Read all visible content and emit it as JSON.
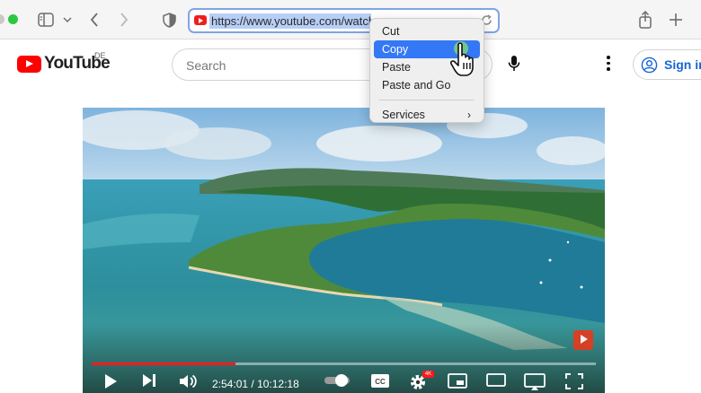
{
  "browser": {
    "url": "https://www.youtube.com/watch?"
  },
  "header": {
    "logo_text": "YouTube",
    "region": "DE",
    "search_placeholder": "Search",
    "signin_label": "Sign in"
  },
  "player": {
    "time_current": "2:54:01",
    "time_total": "10:12:18",
    "progress": 0.285,
    "quality_badge": "4K"
  },
  "context_menu": {
    "items": [
      {
        "label": "Cut"
      },
      {
        "label": "Copy"
      },
      {
        "label": "Paste"
      },
      {
        "label": "Paste and Go"
      }
    ],
    "services": "Services"
  },
  "colors": {
    "accent": "#3478f6",
    "youtube_red": "#ff0000",
    "progress_red": "#ff1a1a"
  },
  "icons": [
    "sidebar-icon",
    "chevron-down-icon",
    "back-icon",
    "forward-icon",
    "shield-icon",
    "share-icon",
    "plus-icon",
    "reload-icon",
    "microphone-icon",
    "more-icon",
    "account-icon",
    "play-icon",
    "next-icon",
    "volume-icon",
    "autoplay-icon",
    "captions-icon",
    "settings-icon",
    "miniplayer-icon",
    "theater-icon",
    "cast-icon",
    "fullscreen-icon",
    "hand-cursor-icon"
  ]
}
